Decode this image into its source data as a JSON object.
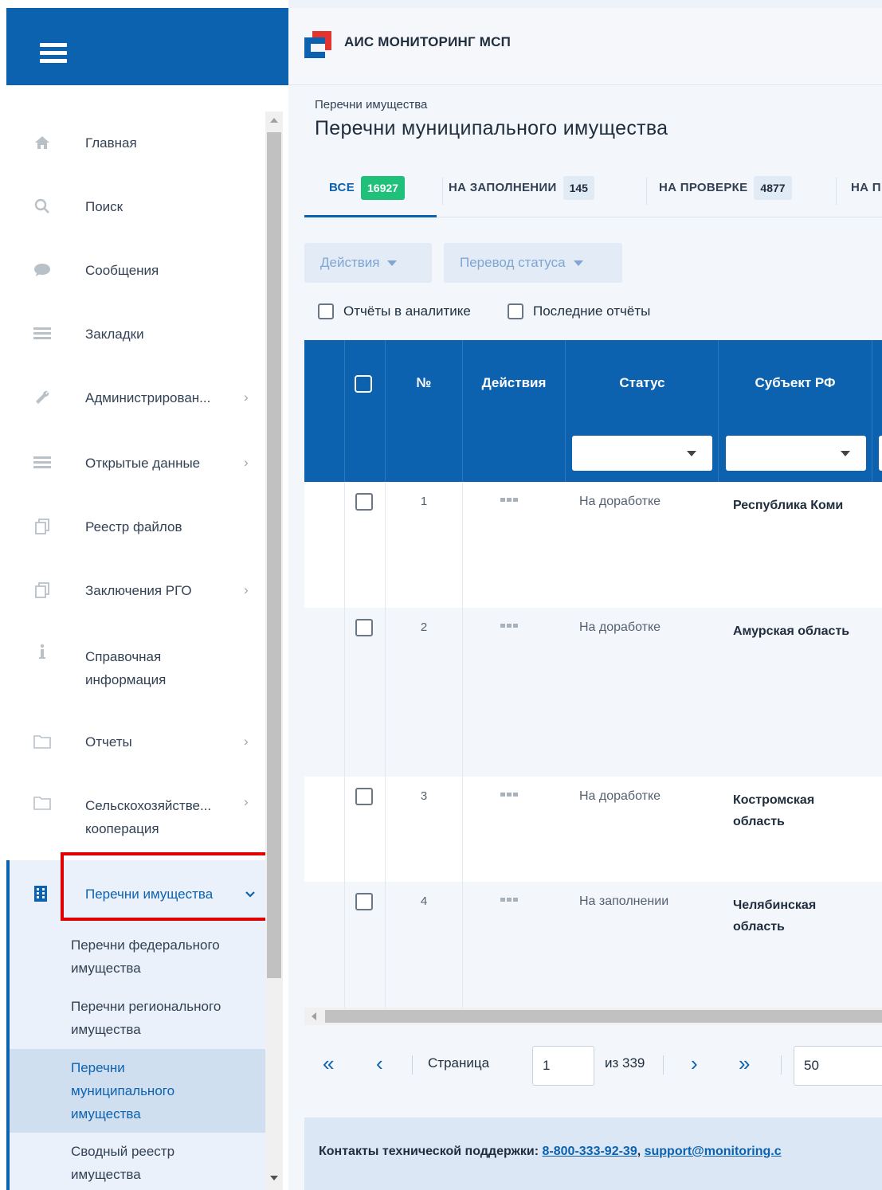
{
  "app": {
    "title": "АИС МОНИТОРИНГ МСП"
  },
  "sidebar": {
    "items": [
      {
        "label": "Главная",
        "icon": "home-icon",
        "has_arrow": false
      },
      {
        "label": "Поиск",
        "icon": "search-icon",
        "has_arrow": false
      },
      {
        "label": "Сообщения",
        "icon": "chat-icon",
        "has_arrow": false
      },
      {
        "label": "Закладки",
        "icon": "list-icon",
        "has_arrow": false
      },
      {
        "label": "Администрирован...",
        "icon": "wrench-icon",
        "has_arrow": true
      },
      {
        "label": "Открытые данные",
        "icon": "list-icon",
        "has_arrow": true
      },
      {
        "label": "Реестр файлов",
        "icon": "files-icon",
        "has_arrow": false
      },
      {
        "label": "Заключения РГО",
        "icon": "files-icon",
        "has_arrow": true
      },
      {
        "label": "Справочная информация",
        "icon": "info-icon",
        "has_arrow": false
      },
      {
        "label": "Отчеты",
        "icon": "folder-icon",
        "has_arrow": true
      },
      {
        "label_line1": "Сельскохозяйстве...",
        "label_line2": "кооперация",
        "icon": "folder-icon",
        "has_arrow": true
      },
      {
        "label": "Перечни имущества",
        "icon": "building-icon",
        "expanded": true
      }
    ],
    "subitems": [
      {
        "label": "Перечни федерального имущества"
      },
      {
        "label": "Перечни регионального имущества"
      },
      {
        "label": "Перечни муниципального имущества",
        "selected": true
      },
      {
        "label": "Сводный реестр имущества"
      }
    ]
  },
  "page": {
    "breadcrumb": "Перечни имущества",
    "title": "Перечни муниципального имущества"
  },
  "tabs": [
    {
      "label": "ВСЕ",
      "count": "16927",
      "active": true
    },
    {
      "label": "НА ЗАПОЛНЕНИИ",
      "count": "145"
    },
    {
      "label": "НА ПРОВЕРКЕ",
      "count": "4877"
    },
    {
      "label": "НА П"
    }
  ],
  "toolbar": {
    "actions_label": "Действия",
    "status_label": "Перевод статуса",
    "checkbox_analytics": "Отчёты в аналитике",
    "checkbox_last": "Последние отчёты"
  },
  "table": {
    "headers": {
      "num": "№",
      "actions": "Действия",
      "status": "Статус",
      "subject": "Субъект РФ"
    },
    "rows": [
      {
        "num": "1",
        "status": "На доработке",
        "subject": "Республика Коми"
      },
      {
        "num": "2",
        "status": "На доработке",
        "subject": "Амурская область"
      },
      {
        "num": "3",
        "status": "На доработке",
        "subject": "Костромская область"
      },
      {
        "num": "4",
        "status": "На заполнении",
        "subject": "Челябинская область"
      }
    ]
  },
  "pager": {
    "page_label": "Страница",
    "page_value": "1",
    "of_label": "из 339",
    "page_size": "50"
  },
  "footer": {
    "label": "Контакты технической поддержки:",
    "phone": "8-800-333-92-39",
    "email": "support@monitoring.c"
  },
  "colors": {
    "brand": "#0c62ae",
    "badge_active": "#1fc07a",
    "highlight": "#e00000"
  }
}
